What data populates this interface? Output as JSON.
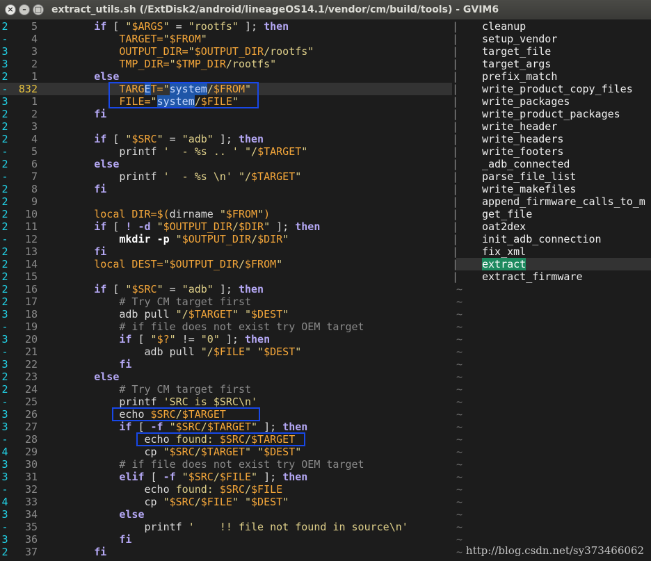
{
  "window": {
    "title": "extract_utils.sh (/ExtDisk2/android/lineageOS14.1/vendor/cm/build/tools) - GVIM6",
    "close_glyph": "×",
    "minimize_glyph": "–",
    "maximize_glyph": "□"
  },
  "code_lines": [
    {
      "fold": "2",
      "num": "5",
      "tokens": [
        {
          "t": "        "
        },
        {
          "t": "if",
          "c": "kw"
        },
        {
          "t": " [ "
        },
        {
          "t": "\"",
          "c": "st"
        },
        {
          "t": "$ARGS",
          "c": "vr"
        },
        {
          "t": "\"",
          "c": "st"
        },
        {
          "t": " = "
        },
        {
          "t": "\"rootfs\"",
          "c": "st"
        },
        {
          "t": " ]; "
        },
        {
          "t": "then",
          "c": "kw"
        }
      ]
    },
    {
      "fold": "-",
      "num": "4",
      "tokens": [
        {
          "t": "            "
        },
        {
          "t": "TARGET=",
          "c": "vr"
        },
        {
          "t": "\"",
          "c": "st"
        },
        {
          "t": "$FROM",
          "c": "vr"
        },
        {
          "t": "\"",
          "c": "st"
        }
      ]
    },
    {
      "fold": "3",
      "num": "3",
      "tokens": [
        {
          "t": "            "
        },
        {
          "t": "OUTPUT_DIR=",
          "c": "vr"
        },
        {
          "t": "\"",
          "c": "st"
        },
        {
          "t": "$OUTPUT_DIR",
          "c": "vr"
        },
        {
          "t": "/rootfs\"",
          "c": "st"
        }
      ]
    },
    {
      "fold": "3",
      "num": "2",
      "tokens": [
        {
          "t": "            "
        },
        {
          "t": "TMP_DIR=",
          "c": "vr"
        },
        {
          "t": "\"",
          "c": "st"
        },
        {
          "t": "$TMP_DIR",
          "c": "vr"
        },
        {
          "t": "/rootfs\"",
          "c": "st"
        }
      ]
    },
    {
      "fold": "2",
      "num": "1",
      "tokens": [
        {
          "t": "        "
        },
        {
          "t": "else",
          "c": "kw"
        }
      ]
    },
    {
      "fold": "-",
      "num": "832",
      "current": true,
      "tokens": [
        {
          "t": "            "
        },
        {
          "t": "TARG",
          "c": "vr"
        },
        {
          "t": "E",
          "c": "sel"
        },
        {
          "t": "T=",
          "c": "vr"
        },
        {
          "t": "\"",
          "c": "st"
        },
        {
          "t": "system",
          "c": "sel"
        },
        {
          "t": "/",
          "c": "st"
        },
        {
          "t": "$FROM",
          "c": "vr"
        },
        {
          "t": "\"",
          "c": "st"
        }
      ]
    },
    {
      "fold": "3",
      "num": "1",
      "tokens": [
        {
          "t": "            "
        },
        {
          "t": "FILE=",
          "c": "vr"
        },
        {
          "t": "\"",
          "c": "st"
        },
        {
          "t": "system",
          "c": "sel"
        },
        {
          "t": "/",
          "c": "st"
        },
        {
          "t": "$FILE",
          "c": "vr"
        },
        {
          "t": "\"",
          "c": "st"
        }
      ]
    },
    {
      "fold": "2",
      "num": "2",
      "tokens": [
        {
          "t": "        "
        },
        {
          "t": "fi",
          "c": "kw"
        }
      ]
    },
    {
      "fold": "2",
      "num": "3",
      "tokens": []
    },
    {
      "fold": "2",
      "num": "4",
      "tokens": [
        {
          "t": "        "
        },
        {
          "t": "if",
          "c": "kw"
        },
        {
          "t": " [ "
        },
        {
          "t": "\"",
          "c": "st"
        },
        {
          "t": "$SRC",
          "c": "vr"
        },
        {
          "t": "\"",
          "c": "st"
        },
        {
          "t": " = "
        },
        {
          "t": "\"adb\"",
          "c": "st"
        },
        {
          "t": " ]; "
        },
        {
          "t": "then",
          "c": "kw"
        }
      ]
    },
    {
      "fold": "-",
      "num": "5",
      "tokens": [
        {
          "t": "            printf "
        },
        {
          "t": "'  - %s .. '",
          "c": "st"
        },
        {
          "t": " "
        },
        {
          "t": "\"/",
          "c": "st"
        },
        {
          "t": "$TARGET",
          "c": "vr"
        },
        {
          "t": "\"",
          "c": "st"
        }
      ]
    },
    {
      "fold": "2",
      "num": "6",
      "tokens": [
        {
          "t": "        "
        },
        {
          "t": "else",
          "c": "kw"
        }
      ]
    },
    {
      "fold": "-",
      "num": "7",
      "tokens": [
        {
          "t": "            printf "
        },
        {
          "t": "'  - %s \\n'",
          "c": "st"
        },
        {
          "t": " "
        },
        {
          "t": "\"/",
          "c": "st"
        },
        {
          "t": "$TARGET",
          "c": "vr"
        },
        {
          "t": "\"",
          "c": "st"
        }
      ]
    },
    {
      "fold": "2",
      "num": "8",
      "tokens": [
        {
          "t": "        "
        },
        {
          "t": "fi",
          "c": "kw"
        }
      ]
    },
    {
      "fold": "2",
      "num": "9",
      "tokens": []
    },
    {
      "fold": "2",
      "num": "10",
      "tokens": [
        {
          "t": "        "
        },
        {
          "t": "local DIR=",
          "c": "vr"
        },
        {
          "t": "$(",
          "c": "vr"
        },
        {
          "t": "dirname "
        },
        {
          "t": "\"",
          "c": "st"
        },
        {
          "t": "$FROM",
          "c": "vr"
        },
        {
          "t": "\"",
          "c": "st"
        },
        {
          "t": ")",
          "c": "vr"
        }
      ]
    },
    {
      "fold": "2",
      "num": "11",
      "tokens": [
        {
          "t": "        "
        },
        {
          "t": "if",
          "c": "kw"
        },
        {
          "t": " [ "
        },
        {
          "t": "! -d",
          "c": "kw"
        },
        {
          "t": " "
        },
        {
          "t": "\"",
          "c": "st"
        },
        {
          "t": "$OUTPUT_DIR",
          "c": "vr"
        },
        {
          "t": "/",
          "c": "st"
        },
        {
          "t": "$DIR",
          "c": "vr"
        },
        {
          "t": "\"",
          "c": "st"
        },
        {
          "t": " ]; "
        },
        {
          "t": "then",
          "c": "kw"
        }
      ]
    },
    {
      "fold": "-",
      "num": "12",
      "tokens": [
        {
          "t": "            "
        },
        {
          "t": "mkdir",
          "c": "cmdname"
        },
        {
          "t": " "
        },
        {
          "t": "-p",
          "c": "cmdname"
        },
        {
          "t": " "
        },
        {
          "t": "\"",
          "c": "st"
        },
        {
          "t": "$OUTPUT_DIR",
          "c": "vr"
        },
        {
          "t": "/",
          "c": "st"
        },
        {
          "t": "$DIR",
          "c": "vr"
        },
        {
          "t": "\"",
          "c": "st"
        }
      ]
    },
    {
      "fold": "2",
      "num": "13",
      "tokens": [
        {
          "t": "        "
        },
        {
          "t": "fi",
          "c": "kw"
        }
      ]
    },
    {
      "fold": "2",
      "num": "14",
      "tokens": [
        {
          "t": "        "
        },
        {
          "t": "local DEST=",
          "c": "vr"
        },
        {
          "t": "\"",
          "c": "st"
        },
        {
          "t": "$OUTPUT_DIR",
          "c": "vr"
        },
        {
          "t": "/",
          "c": "st"
        },
        {
          "t": "$FROM",
          "c": "vr"
        },
        {
          "t": "\"",
          "c": "st"
        }
      ]
    },
    {
      "fold": "2",
      "num": "15",
      "tokens": []
    },
    {
      "fold": "2",
      "num": "16",
      "tokens": [
        {
          "t": "        "
        },
        {
          "t": "if",
          "c": "kw"
        },
        {
          "t": " [ "
        },
        {
          "t": "\"",
          "c": "st"
        },
        {
          "t": "$SRC",
          "c": "vr"
        },
        {
          "t": "\"",
          "c": "st"
        },
        {
          "t": " = "
        },
        {
          "t": "\"adb\"",
          "c": "st"
        },
        {
          "t": " ]; "
        },
        {
          "t": "then",
          "c": "kw"
        }
      ]
    },
    {
      "fold": "2",
      "num": "17",
      "tokens": [
        {
          "t": "            "
        },
        {
          "t": "# Try CM target first",
          "c": "cm"
        }
      ]
    },
    {
      "fold": "3",
      "num": "18",
      "tokens": [
        {
          "t": "            adb pull "
        },
        {
          "t": "\"/",
          "c": "st"
        },
        {
          "t": "$TARGET",
          "c": "vr"
        },
        {
          "t": "\"",
          "c": "st"
        },
        {
          "t": " "
        },
        {
          "t": "\"",
          "c": "st"
        },
        {
          "t": "$DEST",
          "c": "vr"
        },
        {
          "t": "\"",
          "c": "st"
        }
      ]
    },
    {
      "fold": "-",
      "num": "19",
      "tokens": [
        {
          "t": "            "
        },
        {
          "t": "# if file does not exist try OEM target",
          "c": "cm"
        }
      ]
    },
    {
      "fold": "3",
      "num": "20",
      "tokens": [
        {
          "t": "            "
        },
        {
          "t": "if",
          "c": "kw"
        },
        {
          "t": " [ "
        },
        {
          "t": "\"",
          "c": "st"
        },
        {
          "t": "$?",
          "c": "vr"
        },
        {
          "t": "\"",
          "c": "st"
        },
        {
          "t": " != "
        },
        {
          "t": "\"0\"",
          "c": "st"
        },
        {
          "t": " ]; "
        },
        {
          "t": "then",
          "c": "kw"
        }
      ]
    },
    {
      "fold": "-",
      "num": "21",
      "tokens": [
        {
          "t": "                adb pull "
        },
        {
          "t": "\"/",
          "c": "st"
        },
        {
          "t": "$FILE",
          "c": "vr"
        },
        {
          "t": "\"",
          "c": "st"
        },
        {
          "t": " "
        },
        {
          "t": "\"",
          "c": "st"
        },
        {
          "t": "$DEST",
          "c": "vr"
        },
        {
          "t": "\"",
          "c": "st"
        }
      ]
    },
    {
      "fold": "3",
      "num": "22",
      "tokens": [
        {
          "t": "            "
        },
        {
          "t": "fi",
          "c": "kw"
        }
      ]
    },
    {
      "fold": "2",
      "num": "23",
      "tokens": [
        {
          "t": "        "
        },
        {
          "t": "else",
          "c": "kw"
        }
      ]
    },
    {
      "fold": "2",
      "num": "24",
      "tokens": [
        {
          "t": "            "
        },
        {
          "t": "# Try CM target first",
          "c": "cm"
        }
      ]
    },
    {
      "fold": "-",
      "num": "25",
      "tokens": [
        {
          "t": "            printf "
        },
        {
          "t": "'SRC is $SRC\\n'",
          "c": "st"
        }
      ]
    },
    {
      "fold": "3",
      "num": "26",
      "tokens": [
        {
          "t": "            echo "
        },
        {
          "t": "$SRC",
          "c": "vr"
        },
        {
          "t": "/",
          "c": "st"
        },
        {
          "t": "$TARGET",
          "c": "vr"
        }
      ]
    },
    {
      "fold": "3",
      "num": "27",
      "tokens": [
        {
          "t": "            "
        },
        {
          "t": "if",
          "c": "kw"
        },
        {
          "t": " [ "
        },
        {
          "t": "-f",
          "c": "kw"
        },
        {
          "t": " "
        },
        {
          "t": "\"",
          "c": "st"
        },
        {
          "t": "$SRC",
          "c": "vr"
        },
        {
          "t": "/",
          "c": "st"
        },
        {
          "t": "$TARGET",
          "c": "vr"
        },
        {
          "t": "\"",
          "c": "st"
        },
        {
          "t": " ]; "
        },
        {
          "t": "then",
          "c": "kw"
        }
      ]
    },
    {
      "fold": "-",
      "num": "28",
      "tokens": [
        {
          "t": "                echo "
        },
        {
          "t": "found: ",
          "c": "st"
        },
        {
          "t": "$SRC",
          "c": "vr"
        },
        {
          "t": "/",
          "c": "st"
        },
        {
          "t": "$TARGET",
          "c": "vr"
        }
      ]
    },
    {
      "fold": "4",
      "num": "29",
      "tokens": [
        {
          "t": "                cp "
        },
        {
          "t": "\"",
          "c": "st"
        },
        {
          "t": "$SRC",
          "c": "vr"
        },
        {
          "t": "/",
          "c": "st"
        },
        {
          "t": "$TARGET",
          "c": "vr"
        },
        {
          "t": "\"",
          "c": "st"
        },
        {
          "t": " "
        },
        {
          "t": "\"",
          "c": "st"
        },
        {
          "t": "$DEST",
          "c": "vr"
        },
        {
          "t": "\"",
          "c": "st"
        }
      ]
    },
    {
      "fold": "3",
      "num": "30",
      "tokens": [
        {
          "t": "            "
        },
        {
          "t": "# if file does not exist try OEM target",
          "c": "cm"
        }
      ]
    },
    {
      "fold": "3",
      "num": "31",
      "tokens": [
        {
          "t": "            "
        },
        {
          "t": "elif",
          "c": "kw"
        },
        {
          "t": " [ "
        },
        {
          "t": "-f",
          "c": "kw"
        },
        {
          "t": " "
        },
        {
          "t": "\"",
          "c": "st"
        },
        {
          "t": "$SRC",
          "c": "vr"
        },
        {
          "t": "/",
          "c": "st"
        },
        {
          "t": "$FILE",
          "c": "vr"
        },
        {
          "t": "\"",
          "c": "st"
        },
        {
          "t": " ]; "
        },
        {
          "t": "then",
          "c": "kw"
        }
      ]
    },
    {
      "fold": "-",
      "num": "32",
      "tokens": [
        {
          "t": "                echo "
        },
        {
          "t": "found: ",
          "c": "st"
        },
        {
          "t": "$SRC",
          "c": "vr"
        },
        {
          "t": "/",
          "c": "st"
        },
        {
          "t": "$FILE",
          "c": "vr"
        }
      ]
    },
    {
      "fold": "4",
      "num": "33",
      "tokens": [
        {
          "t": "                cp "
        },
        {
          "t": "\"",
          "c": "st"
        },
        {
          "t": "$SRC",
          "c": "vr"
        },
        {
          "t": "/",
          "c": "st"
        },
        {
          "t": "$FILE",
          "c": "vr"
        },
        {
          "t": "\"",
          "c": "st"
        },
        {
          "t": " "
        },
        {
          "t": "\"",
          "c": "st"
        },
        {
          "t": "$DEST",
          "c": "vr"
        },
        {
          "t": "\"",
          "c": "st"
        }
      ]
    },
    {
      "fold": "3",
      "num": "34",
      "tokens": [
        {
          "t": "            "
        },
        {
          "t": "else",
          "c": "kw"
        }
      ]
    },
    {
      "fold": "-",
      "num": "35",
      "tokens": [
        {
          "t": "                printf "
        },
        {
          "t": "'    !! file not found in source\\n'",
          "c": "st"
        }
      ]
    },
    {
      "fold": "3",
      "num": "36",
      "tokens": [
        {
          "t": "            "
        },
        {
          "t": "fi",
          "c": "kw"
        }
      ]
    },
    {
      "fold": "2",
      "num": "37",
      "tokens": [
        {
          "t": "        "
        },
        {
          "t": "fi",
          "c": "kw"
        }
      ]
    }
  ],
  "function_list": [
    "cleanup",
    "setup_vendor",
    "target_file",
    "target_args",
    "prefix_match",
    "write_product_copy_files",
    "write_packages",
    "write_product_packages",
    "write_header",
    "write_headers",
    "write_footers",
    "_adb_connected",
    "parse_file_list",
    "write_makefiles",
    "append_firmware_calls_to_m",
    "get_file",
    "oat2dex",
    "init_adb_connection",
    "fix_xml",
    "extract",
    "extract_firmware"
  ],
  "active_function": "extract",
  "separator_glyph": "|",
  "tilde_glyph": "~",
  "tilde_rows": 22,
  "watermark": "http://blog.csdn.net/sy373466062",
  "colors": {
    "background": "#1c1c1c",
    "keyword": "#b5a8f5",
    "string": "#dfd08a",
    "variable": "#f5a73a",
    "comment": "#8a8a8a",
    "fold_column": "#22d3e8",
    "current_line_number": "#e7c23e",
    "search_highlight": "#1f56a8",
    "annotation_box": "#1848e8",
    "taglist_active": "#1e8a5f"
  },
  "annotations": [
    {
      "label": "target-file-assignments-box"
    },
    {
      "label": "echo-src-target-box"
    },
    {
      "label": "echo-found-box"
    }
  ]
}
